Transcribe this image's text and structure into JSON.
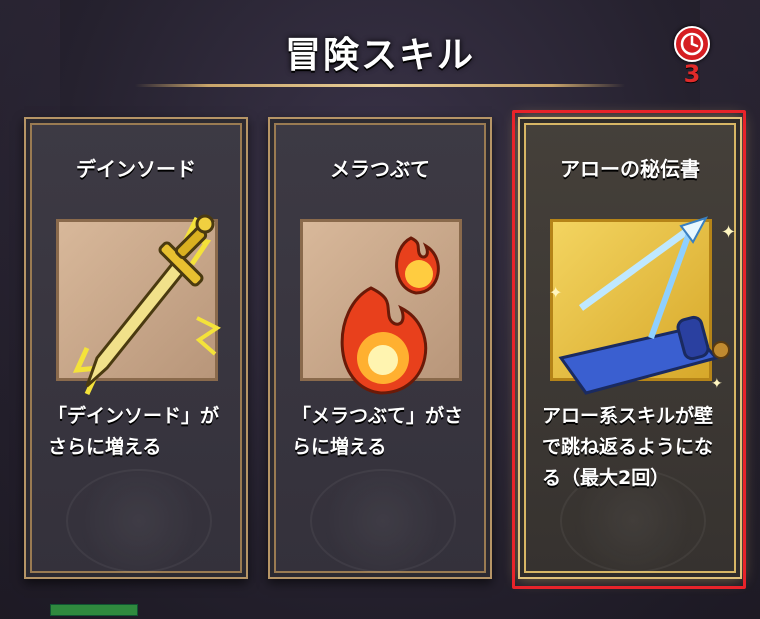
{
  "title": "冒険スキル",
  "timer": {
    "icon": "clock-icon",
    "count": "3"
  },
  "cards": [
    {
      "name": "デインソード",
      "icon": "lightning-sword-icon",
      "description": "「デインソード」がさらに増える",
      "desc_lines": [
        "「デインソード」が",
        "さらに増える"
      ]
    },
    {
      "name": "メラつぶて",
      "icon": "fireballs-icon",
      "description": "「メラつぶて」がさらに増える",
      "desc_lines": [
        "「メラつぶて」がさ",
        "らに増える"
      ]
    },
    {
      "name": "アローの秘伝書",
      "icon": "arrow-scroll-icon",
      "description": "アロー系スキルが壁で跳ね返るようになる（最大2回）",
      "desc_lines": [
        "アロー系スキルが壁",
        "で跳ね返るようにな",
        "る（最大2回）"
      ],
      "selected": true
    }
  ],
  "colors": {
    "selection": "#e8232a",
    "gold": "#e0c17a",
    "timer": "#d51e22"
  }
}
